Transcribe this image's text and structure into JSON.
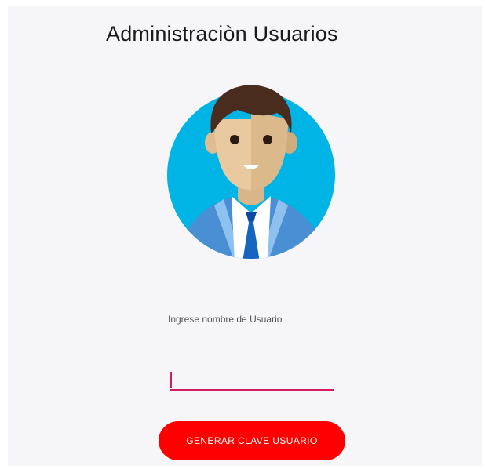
{
  "header": {
    "title": "Administraciòn Usuarios"
  },
  "avatar": {
    "icon": "user-avatar-businessman-icon",
    "colors": {
      "background": "#00b4e6",
      "hair": "#4a2c1f",
      "skin": "#e8c9a0",
      "jacket": "#4a8fd4",
      "tie": "#1565c0"
    }
  },
  "form": {
    "label": "Ingrese nombre de Usuario",
    "input_value": "",
    "accent_color": "#d81b60"
  },
  "actions": {
    "generate_label": "GENERAR CLAVE USUARIO",
    "button_color": "#ff0000"
  }
}
